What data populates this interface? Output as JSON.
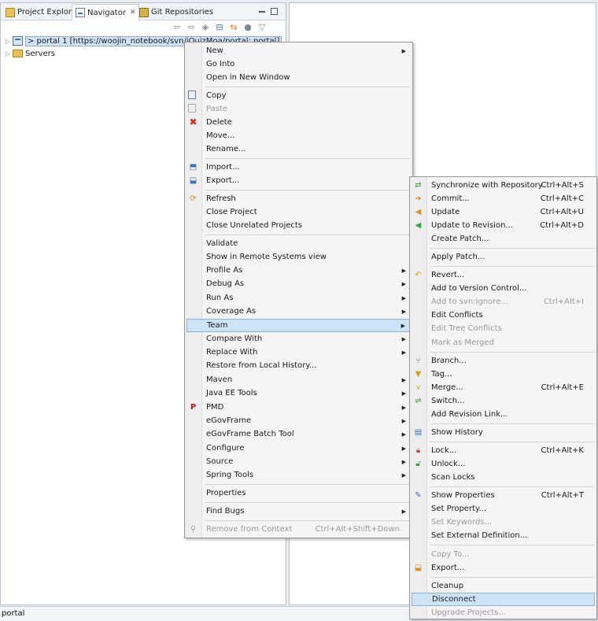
{
  "tabs": {
    "project_explorer": "Project Explorer",
    "navigator": "Navigator",
    "git_repositories": "Git Repositories"
  },
  "tree": {
    "project": "> portal 1 [https://woojin_notebook/svn/jQuizMoa/portal: portal]",
    "servers": "Servers"
  },
  "status_bar": "portal",
  "context_menu": {
    "new": "New",
    "go_into": "Go Into",
    "open_in_new_window": "Open in New Window",
    "copy": "Copy",
    "paste": "Paste",
    "delete": "Delete",
    "move": "Move...",
    "rename": "Rename...",
    "import": "Import...",
    "export": "Export...",
    "refresh": "Refresh",
    "close_project": "Close Project",
    "close_unrelated": "Close Unrelated Projects",
    "validate": "Validate",
    "show_remote": "Show in Remote Systems view",
    "profile_as": "Profile As",
    "debug_as": "Debug As",
    "run_as": "Run As",
    "coverage_as": "Coverage As",
    "team": "Team",
    "compare_with": "Compare With",
    "replace_with": "Replace With",
    "restore_history": "Restore from Local History...",
    "maven": "Maven",
    "java_ee_tools": "Java EE Tools",
    "pmd": "PMD",
    "egovframe": "eGovFrame",
    "egovframe_batch": "eGovFrame Batch Tool",
    "configure": "Configure",
    "source": "Source",
    "spring_tools": "Spring Tools",
    "properties": "Properties",
    "find_bugs": "Find Bugs",
    "remove_context": "Remove from Context",
    "remove_context_shortcut": "Ctrl+Alt+Shift+Down"
  },
  "team_menu": {
    "synchronize": "Synchronize with Repository",
    "synchronize_shortcut": "Ctrl+Alt+S",
    "commit": "Commit...",
    "commit_shortcut": "Ctrl+Alt+C",
    "update": "Update",
    "update_shortcut": "Ctrl+Alt+U",
    "update_revision": "Update to Revision...",
    "update_revision_shortcut": "Ctrl+Alt+D",
    "create_patch": "Create Patch...",
    "apply_patch": "Apply Patch...",
    "revert": "Revert...",
    "add_version_control": "Add to Version Control...",
    "add_svnignore": "Add to svn:ignore...",
    "add_svnignore_shortcut": "Ctrl+Alt+I",
    "edit_conflicts": "Edit Conflicts",
    "edit_tree_conflicts": "Edit Tree Conflicts",
    "mark_merged": "Mark as Merged",
    "branch": "Branch...",
    "tag": "Tag...",
    "merge": "Merge...",
    "merge_shortcut": "Ctrl+Alt+E",
    "switch": "Switch...",
    "add_revision_link": "Add Revision Link...",
    "show_history": "Show History",
    "lock": "Lock...",
    "lock_shortcut": "Ctrl+Alt+K",
    "unlock": "Unlock...",
    "scan_locks": "Scan Locks",
    "show_properties": "Show Properties",
    "show_properties_shortcut": "Ctrl+Alt+T",
    "set_property": "Set Property...",
    "set_keywords": "Set Keywords...",
    "set_external": "Set External Definition...",
    "copy_to": "Copy To...",
    "export": "Export...",
    "cleanup": "Cleanup",
    "disconnect": "Disconnect",
    "upgrade_projects": "Upgrade Projects..."
  }
}
